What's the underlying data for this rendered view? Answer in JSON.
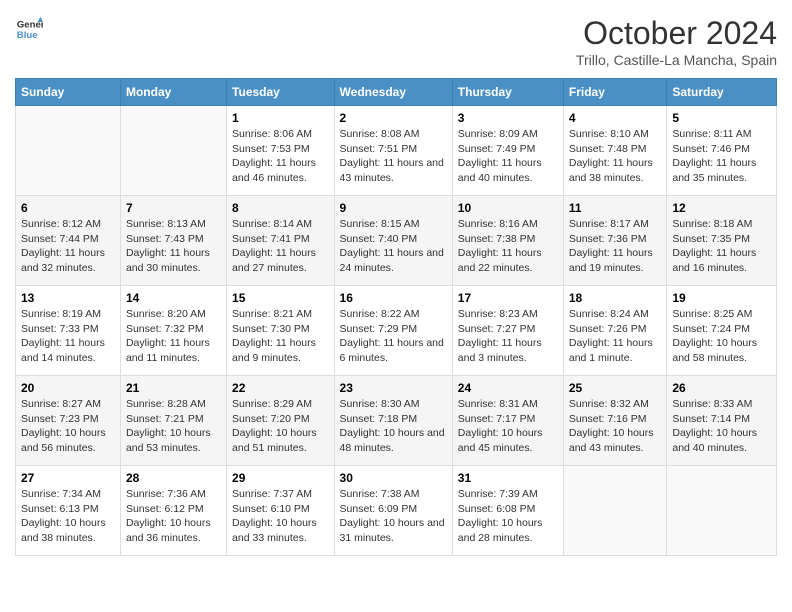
{
  "header": {
    "logo_line1": "General",
    "logo_line2": "Blue",
    "month": "October 2024",
    "location": "Trillo, Castille-La Mancha, Spain"
  },
  "days_of_week": [
    "Sunday",
    "Monday",
    "Tuesday",
    "Wednesday",
    "Thursday",
    "Friday",
    "Saturday"
  ],
  "weeks": [
    [
      {
        "day": "",
        "info": ""
      },
      {
        "day": "",
        "info": ""
      },
      {
        "day": "1",
        "info": "Sunrise: 8:06 AM\nSunset: 7:53 PM\nDaylight: 11 hours and 46 minutes."
      },
      {
        "day": "2",
        "info": "Sunrise: 8:08 AM\nSunset: 7:51 PM\nDaylight: 11 hours and 43 minutes."
      },
      {
        "day": "3",
        "info": "Sunrise: 8:09 AM\nSunset: 7:49 PM\nDaylight: 11 hours and 40 minutes."
      },
      {
        "day": "4",
        "info": "Sunrise: 8:10 AM\nSunset: 7:48 PM\nDaylight: 11 hours and 38 minutes."
      },
      {
        "day": "5",
        "info": "Sunrise: 8:11 AM\nSunset: 7:46 PM\nDaylight: 11 hours and 35 minutes."
      }
    ],
    [
      {
        "day": "6",
        "info": "Sunrise: 8:12 AM\nSunset: 7:44 PM\nDaylight: 11 hours and 32 minutes."
      },
      {
        "day": "7",
        "info": "Sunrise: 8:13 AM\nSunset: 7:43 PM\nDaylight: 11 hours and 30 minutes."
      },
      {
        "day": "8",
        "info": "Sunrise: 8:14 AM\nSunset: 7:41 PM\nDaylight: 11 hours and 27 minutes."
      },
      {
        "day": "9",
        "info": "Sunrise: 8:15 AM\nSunset: 7:40 PM\nDaylight: 11 hours and 24 minutes."
      },
      {
        "day": "10",
        "info": "Sunrise: 8:16 AM\nSunset: 7:38 PM\nDaylight: 11 hours and 22 minutes."
      },
      {
        "day": "11",
        "info": "Sunrise: 8:17 AM\nSunset: 7:36 PM\nDaylight: 11 hours and 19 minutes."
      },
      {
        "day": "12",
        "info": "Sunrise: 8:18 AM\nSunset: 7:35 PM\nDaylight: 11 hours and 16 minutes."
      }
    ],
    [
      {
        "day": "13",
        "info": "Sunrise: 8:19 AM\nSunset: 7:33 PM\nDaylight: 11 hours and 14 minutes."
      },
      {
        "day": "14",
        "info": "Sunrise: 8:20 AM\nSunset: 7:32 PM\nDaylight: 11 hours and 11 minutes."
      },
      {
        "day": "15",
        "info": "Sunrise: 8:21 AM\nSunset: 7:30 PM\nDaylight: 11 hours and 9 minutes."
      },
      {
        "day": "16",
        "info": "Sunrise: 8:22 AM\nSunset: 7:29 PM\nDaylight: 11 hours and 6 minutes."
      },
      {
        "day": "17",
        "info": "Sunrise: 8:23 AM\nSunset: 7:27 PM\nDaylight: 11 hours and 3 minutes."
      },
      {
        "day": "18",
        "info": "Sunrise: 8:24 AM\nSunset: 7:26 PM\nDaylight: 11 hours and 1 minute."
      },
      {
        "day": "19",
        "info": "Sunrise: 8:25 AM\nSunset: 7:24 PM\nDaylight: 10 hours and 58 minutes."
      }
    ],
    [
      {
        "day": "20",
        "info": "Sunrise: 8:27 AM\nSunset: 7:23 PM\nDaylight: 10 hours and 56 minutes."
      },
      {
        "day": "21",
        "info": "Sunrise: 8:28 AM\nSunset: 7:21 PM\nDaylight: 10 hours and 53 minutes."
      },
      {
        "day": "22",
        "info": "Sunrise: 8:29 AM\nSunset: 7:20 PM\nDaylight: 10 hours and 51 minutes."
      },
      {
        "day": "23",
        "info": "Sunrise: 8:30 AM\nSunset: 7:18 PM\nDaylight: 10 hours and 48 minutes."
      },
      {
        "day": "24",
        "info": "Sunrise: 8:31 AM\nSunset: 7:17 PM\nDaylight: 10 hours and 45 minutes."
      },
      {
        "day": "25",
        "info": "Sunrise: 8:32 AM\nSunset: 7:16 PM\nDaylight: 10 hours and 43 minutes."
      },
      {
        "day": "26",
        "info": "Sunrise: 8:33 AM\nSunset: 7:14 PM\nDaylight: 10 hours and 40 minutes."
      }
    ],
    [
      {
        "day": "27",
        "info": "Sunrise: 7:34 AM\nSunset: 6:13 PM\nDaylight: 10 hours and 38 minutes."
      },
      {
        "day": "28",
        "info": "Sunrise: 7:36 AM\nSunset: 6:12 PM\nDaylight: 10 hours and 36 minutes."
      },
      {
        "day": "29",
        "info": "Sunrise: 7:37 AM\nSunset: 6:10 PM\nDaylight: 10 hours and 33 minutes."
      },
      {
        "day": "30",
        "info": "Sunrise: 7:38 AM\nSunset: 6:09 PM\nDaylight: 10 hours and 31 minutes."
      },
      {
        "day": "31",
        "info": "Sunrise: 7:39 AM\nSunset: 6:08 PM\nDaylight: 10 hours and 28 minutes."
      },
      {
        "day": "",
        "info": ""
      },
      {
        "day": "",
        "info": ""
      }
    ]
  ]
}
